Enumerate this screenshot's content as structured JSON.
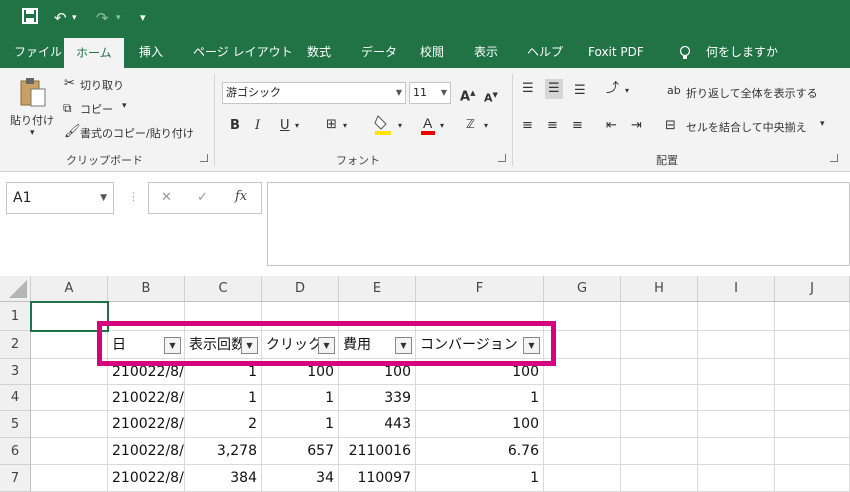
{
  "quick_access": {
    "undo": "↶",
    "redo": "↷",
    "customize": "▾"
  },
  "tabs": [
    "ファイル",
    "ホーム",
    "挿入",
    "ページ レイアウト",
    "数式",
    "データ",
    "校閲",
    "表示",
    "ヘルプ",
    "Foxit PDF",
    "何をしますか"
  ],
  "ribbon": {
    "clipboard": {
      "paste": "貼り付け",
      "cut": "切り取り",
      "copy": "コピー",
      "format_painter": "書式のコピー/貼り付け",
      "group": "クリップボード"
    },
    "font": {
      "name": "游ゴシック",
      "size": "11",
      "bold": "B",
      "italic": "I",
      "underline": "U",
      "group": "フォント"
    },
    "alignment": {
      "wrap_text": "折り返して全体を表示する",
      "merge_center": "セルを結合して中央揃え",
      "group": "配置"
    }
  },
  "formula_bar": {
    "name_box": "A1",
    "cancel": "✕",
    "enter": "✓",
    "fx": "fx",
    "content": ""
  },
  "sheet": {
    "columns": [
      "A",
      "B",
      "C",
      "D",
      "E",
      "F",
      "G",
      "H",
      "I",
      "J"
    ],
    "rows": [
      "1",
      "2",
      "3",
      "4",
      "5",
      "6",
      "7"
    ],
    "headers": [
      "日",
      "表示回数",
      "クリック",
      "費用",
      "コンバージョン"
    ],
    "data": [
      [
        "210022/8/",
        "1",
        "100",
        "100",
        "100"
      ],
      [
        "210022/8/",
        "1",
        "1",
        "339",
        "1"
      ],
      [
        "210022/8/",
        "2",
        "1",
        "443",
        "100"
      ],
      [
        "210022/8/",
        "3,278",
        "657",
        "2110016",
        "6.76"
      ],
      [
        "210022/8/",
        "384",
        "34",
        "110097",
        "1"
      ]
    ]
  },
  "colors": {
    "brand": "#217346",
    "highlight": "#d6007f"
  }
}
